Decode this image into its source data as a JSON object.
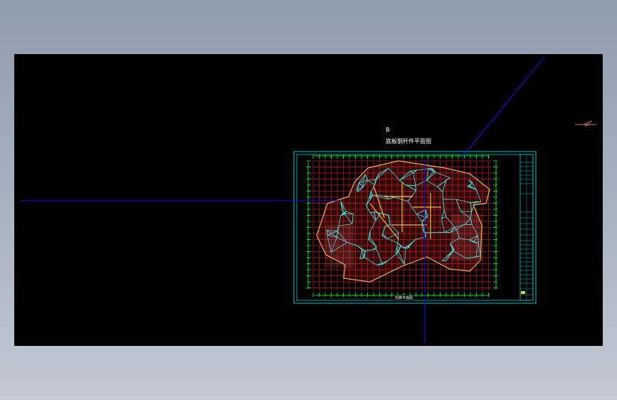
{
  "drawing": {
    "label_top": "B",
    "title": "底板钢杆件平面图",
    "subtitle": "柱脚平面图"
  },
  "colors": {
    "background_page": "#9aa6b7",
    "viewport": "#000000",
    "grid": "#c01a1a",
    "frame": "#00c8c8",
    "axis_ticks": "#19d119",
    "members": "#40e0e0",
    "outline": "#e8b060",
    "crosshair": "#1010ee"
  },
  "icons": {
    "cursor": "crosshair-cursor-icon",
    "north": "north-arrow-icon"
  }
}
